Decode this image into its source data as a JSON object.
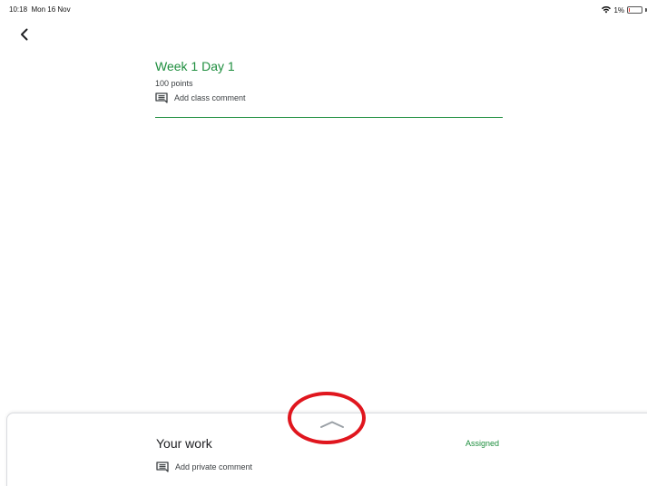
{
  "status_bar": {
    "time": "10:18",
    "date": "Mon 16 Nov",
    "battery": "1%",
    "icons": [
      "wifi-icon",
      "battery-icon"
    ]
  },
  "nav": {
    "back_icon": "chevron-left-icon"
  },
  "assignment": {
    "title": "Week 1 Day 1",
    "points": "100 points",
    "class_comment_label": "Add class comment",
    "accent_color": "#1e8e3e"
  },
  "your_work": {
    "title": "Your work",
    "status": "Assigned",
    "private_comment_label": "Add private comment",
    "handle_icon": "chevron-up-icon"
  },
  "annotation": {
    "color": "#e0161e",
    "shape": "ellipse-highlight"
  }
}
